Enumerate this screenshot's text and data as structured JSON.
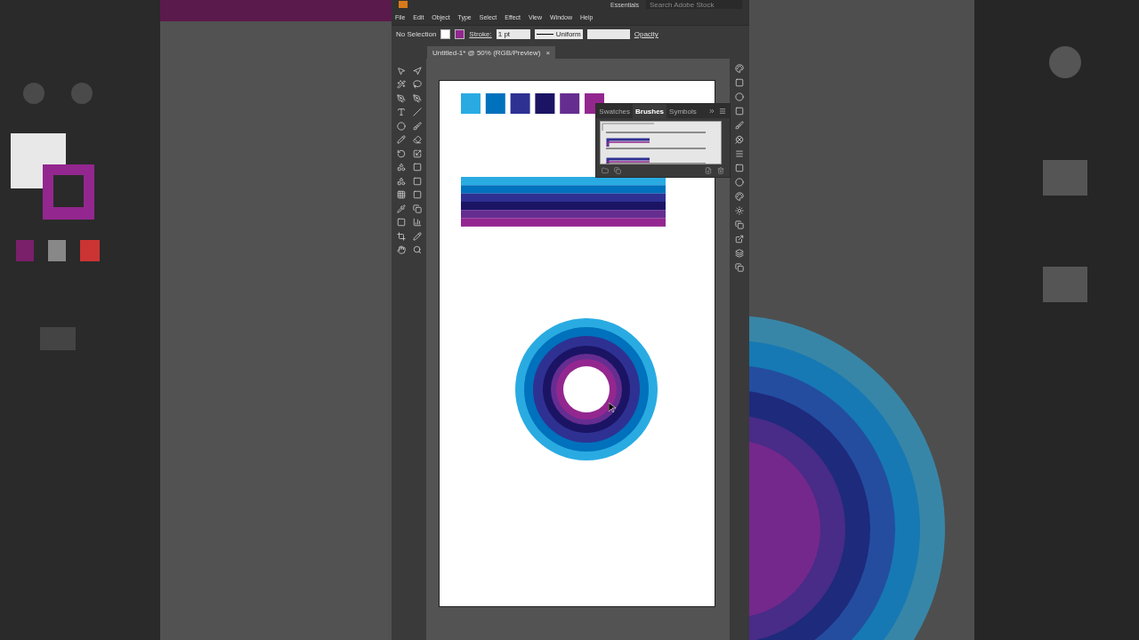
{
  "title_bar": {
    "workspace": "Essentials",
    "search": {
      "placeholder": "Search Adobe Stock"
    }
  },
  "menu": [
    "File",
    "Edit",
    "Object",
    "Type",
    "Select",
    "Effect",
    "View",
    "Window",
    "Help"
  ],
  "control_bar": {
    "selection": "No Selection",
    "stroke_label": "Stroke:",
    "stroke_weight": "1 pt",
    "profile": "Uniform",
    "opacity_label": "Opacity"
  },
  "document_tab": {
    "title": "Untitled-1* @ 50% (RGB/Preview)",
    "close": "×"
  },
  "brushes_panel": {
    "tabs": [
      {
        "label": "Swatches",
        "selected": false
      },
      {
        "label": "Brushes",
        "selected": true
      },
      {
        "label": "Symbols",
        "selected": false
      }
    ]
  },
  "artboard": {
    "swatches": [
      {
        "color": "#29abe2"
      },
      {
        "color": "#0071bc"
      },
      {
        "color": "#2e3192"
      },
      {
        "color": "#1b1464"
      },
      {
        "color": "#662d91"
      },
      {
        "color": "#93278f"
      }
    ],
    "stripes": [
      {
        "color": "#29abe2"
      },
      {
        "color": "#0071bc"
      },
      {
        "color": "#2e3192"
      },
      {
        "color": "#1b1464"
      },
      {
        "color": "#662d91"
      },
      {
        "color": "#93278f"
      }
    ],
    "rings": [
      {
        "color": "#29abe2"
      },
      {
        "color": "#0071bc"
      },
      {
        "color": "#2e3192"
      },
      {
        "color": "#1b1464"
      },
      {
        "color": "#662d91"
      },
      {
        "color": "#93278f"
      }
    ]
  }
}
